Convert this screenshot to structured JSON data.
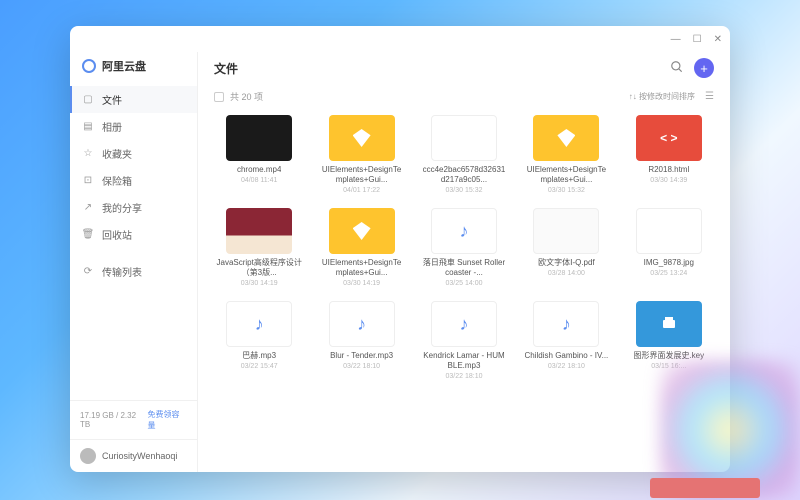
{
  "brand": {
    "title": "阿里云盘"
  },
  "sidebar": {
    "items": [
      {
        "label": "文件",
        "icon": "file"
      },
      {
        "label": "相册",
        "icon": "album"
      },
      {
        "label": "收藏夹",
        "icon": "star"
      },
      {
        "label": "保险箱",
        "icon": "lock"
      },
      {
        "label": "我的分享",
        "icon": "share"
      },
      {
        "label": "回收站",
        "icon": "trash"
      }
    ],
    "transfer": {
      "label": "传输列表",
      "icon": "transfer"
    }
  },
  "storage": {
    "text": "17.19 GB / 2.32 TB",
    "link": "免费领容量"
  },
  "user": {
    "name": "CuriosityWenhaoqi"
  },
  "header": {
    "title": "文件"
  },
  "toolbar": {
    "count": "共 20 项",
    "sort": "↑↓ 按修改时间排序"
  },
  "files": [
    {
      "name": "chrome.mp4",
      "date": "04/08 11:41",
      "thumb": "black"
    },
    {
      "name": "UIElements+DesignTemplates+Gui...",
      "date": "04/01 17:22",
      "thumb": "sketch"
    },
    {
      "name": "ccc4e2bac6578d32631d217a9c05...",
      "date": "03/30 15:32",
      "thumb": "white"
    },
    {
      "name": "UIElements+DesignTemplates+Gui...",
      "date": "03/30 15:32",
      "thumb": "sketch"
    },
    {
      "name": "R2018.html",
      "date": "03/30 14:39",
      "thumb": "html"
    },
    {
      "name": "JavaScript高级程序设计（第3版...",
      "date": "03/30 14:19",
      "thumb": "book"
    },
    {
      "name": "UIElements+DesignTemplates+Gui...",
      "date": "03/30 14:19",
      "thumb": "sketch"
    },
    {
      "name": "落日飛車 Sunset Rollercoaster -...",
      "date": "03/25 14:00",
      "thumb": "audio"
    },
    {
      "name": "欧文字体Ⅰ-Q.pdf",
      "date": "03/28 14:00",
      "thumb": "pdf"
    },
    {
      "name": "IMG_9878.jpg",
      "date": "03/25 13:24",
      "thumb": "white"
    },
    {
      "name": "巴赫.mp3",
      "date": "03/22 15:47",
      "thumb": "audio"
    },
    {
      "name": "Blur - Tender.mp3",
      "date": "03/22 18:10",
      "thumb": "audio"
    },
    {
      "name": "Kendrick Lamar - HUMBLE.mp3",
      "date": "03/22 18:10",
      "thumb": "audio"
    },
    {
      "name": "Childish Gambino - IV...",
      "date": "03/22 18:10",
      "thumb": "audio"
    },
    {
      "name": "图形界面发展史.key",
      "date": "03/15 16:...",
      "thumb": "key"
    }
  ],
  "iconGlyph": {
    "file": "▢",
    "album": "▤",
    "star": "☆",
    "lock": "⊡",
    "share": "↗",
    "trash": "🗑",
    "transfer": "⟳"
  }
}
